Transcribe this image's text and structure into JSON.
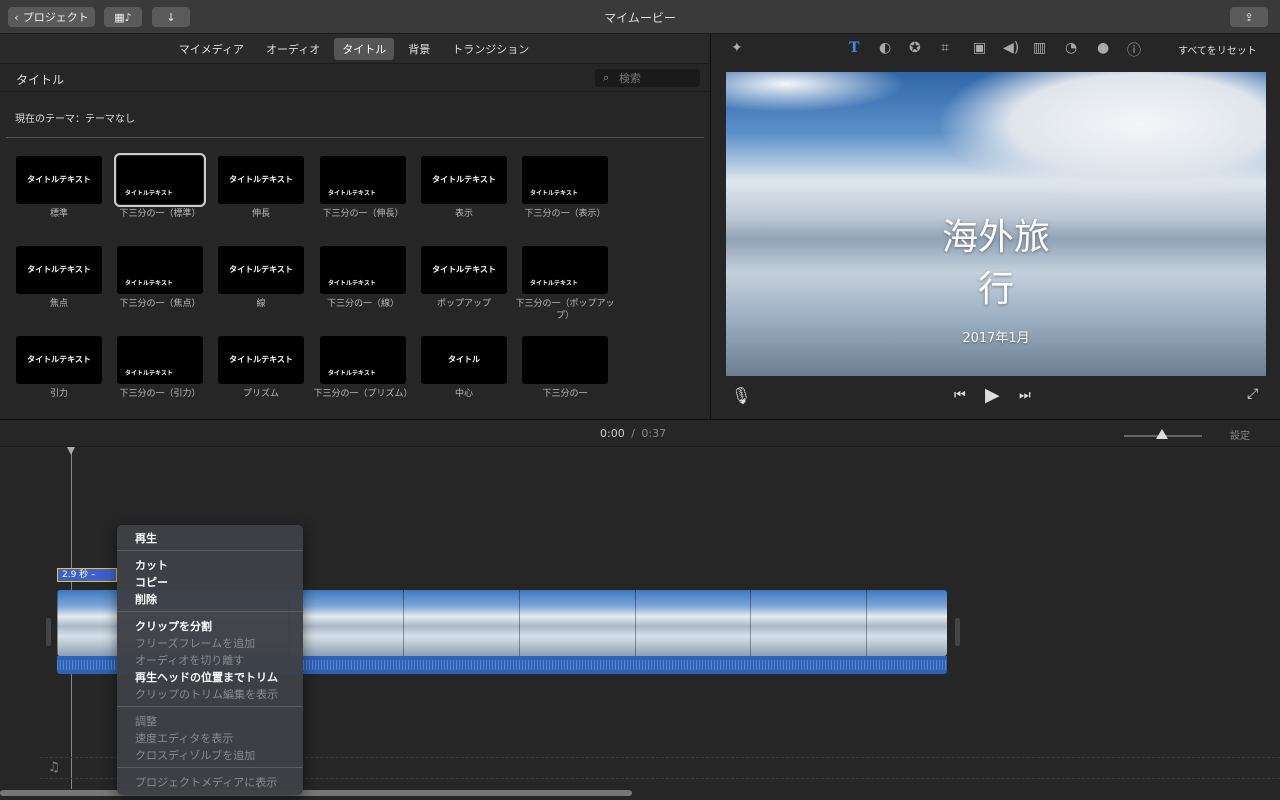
{
  "window": {
    "title": "マイムービー"
  },
  "toolbar": {
    "back_label": "プロジェクト"
  },
  "browser": {
    "tabs": [
      {
        "label": "マイメディア",
        "active": false
      },
      {
        "label": "オーディオ",
        "active": false
      },
      {
        "label": "タイトル",
        "active": true
      },
      {
        "label": "背景",
        "active": false
      },
      {
        "label": "トランジション",
        "active": false
      }
    ],
    "section_title": "タイトル",
    "search_placeholder": "検索",
    "theme_label": "現在のテーマ：テーマなし",
    "titles": [
      {
        "label": "標準",
        "thumb_text": "タイトルテキスト",
        "selected": false
      },
      {
        "label": "下三分の一（標準）",
        "thumb_text": "タイトルテキスト",
        "selected": true
      },
      {
        "label": "伸長",
        "thumb_text": "タイトルテキスト",
        "selected": false
      },
      {
        "label": "下三分の一（伸長）",
        "thumb_text": "タイトルテキスト",
        "selected": false
      },
      {
        "label": "表示",
        "thumb_text": "タイトルテキスト",
        "selected": false
      },
      {
        "label": "下三分の一（表示）",
        "thumb_text": "タイトルテキスト",
        "selected": false
      },
      {
        "label": "焦点",
        "thumb_text": "タイトルテキスト",
        "selected": false
      },
      {
        "label": "下三分の一（焦点）",
        "thumb_text": "タイトルテキスト",
        "selected": false
      },
      {
        "label": "線",
        "thumb_text": "タイトルテキスト",
        "selected": false
      },
      {
        "label": "下三分の一（線）",
        "thumb_text": "タイトルテキスト",
        "selected": false
      },
      {
        "label": "ポップアップ",
        "thumb_text": "タイトルテキスト",
        "selected": false
      },
      {
        "label": "下三分の一（ポップアップ）",
        "thumb_text": "タイトルテキスト",
        "selected": false
      },
      {
        "label": "引力",
        "thumb_text": "タイトルテキスト",
        "selected": false
      },
      {
        "label": "下三分の一（引力）",
        "thumb_text": "タイトルテキスト",
        "selected": false
      },
      {
        "label": "プリズム",
        "thumb_text": "タイトルテキスト",
        "selected": false
      },
      {
        "label": "下三分の一（プリズム）",
        "thumb_text": "タイトルテキスト",
        "selected": false
      },
      {
        "label": "中心",
        "thumb_text": "タイトル",
        "selected": false
      },
      {
        "label": "下三分の一",
        "thumb_text": "",
        "selected": false
      }
    ]
  },
  "viewer": {
    "reset_label": "すべてをリセット",
    "video_title": "海外旅行",
    "video_subtitle": "2017年1月"
  },
  "timeline": {
    "current_time": "0:00",
    "separator": "/",
    "total_time": "0:37",
    "settings_label": "設定",
    "clip_duration": "2.9 秒 –"
  },
  "context_menu": {
    "items": [
      {
        "label": "再生",
        "enabled": true
      },
      {
        "label": "カット",
        "enabled": true
      },
      {
        "label": "コピー",
        "enabled": true
      },
      {
        "label": "削除",
        "enabled": true
      },
      {
        "label": "クリップを分割",
        "enabled": true
      },
      {
        "label": "フリーズフレームを追加",
        "enabled": false
      },
      {
        "label": "オーディオを切り離す",
        "enabled": false
      },
      {
        "label": "再生ヘッドの位置までトリム",
        "enabled": true
      },
      {
        "label": "クリップのトリム編集を表示",
        "enabled": false
      },
      {
        "label": "調整",
        "enabled": false
      },
      {
        "label": "速度エディタを表示",
        "enabled": false
      },
      {
        "label": "クロスディゾルブを追加",
        "enabled": false
      },
      {
        "label": "プロジェクトメディアに表示",
        "enabled": false
      }
    ]
  }
}
